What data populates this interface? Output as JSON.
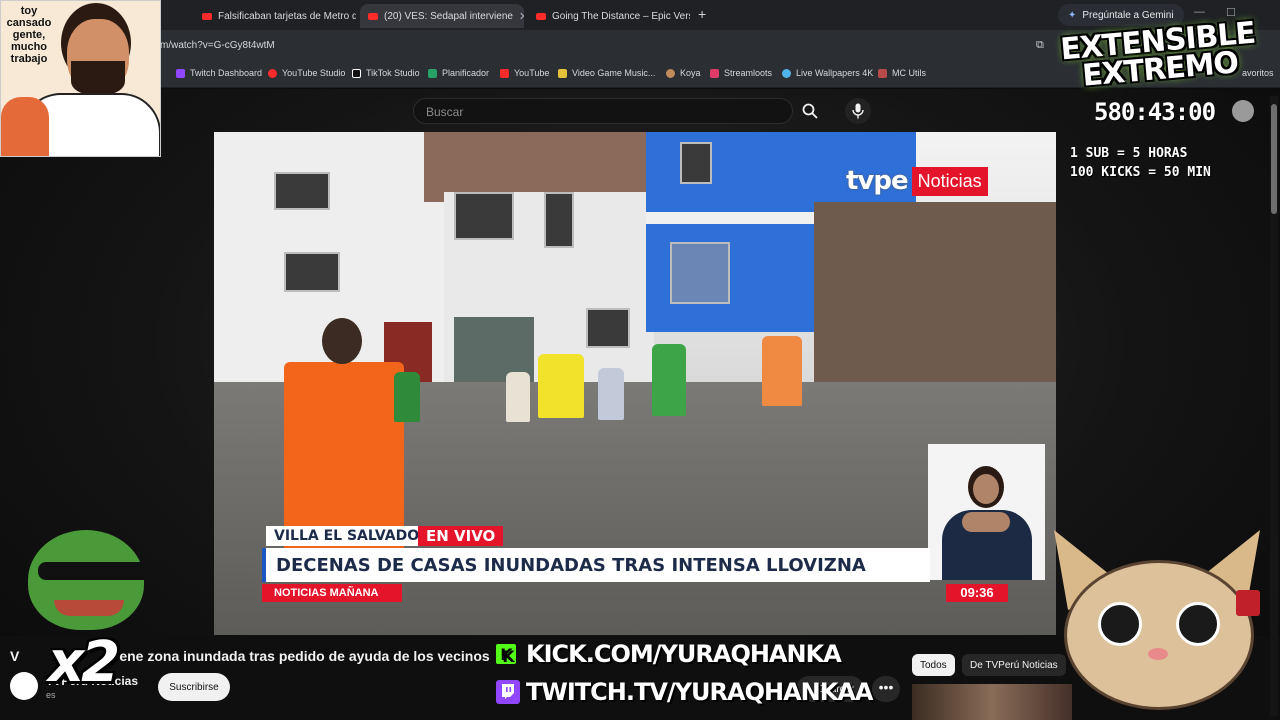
{
  "browser": {
    "tabs": [
      {
        "label": "Falsificaban tarjetas de Metro d"
      },
      {
        "label": "(20) VES: Sedapal interviene"
      },
      {
        "label": "Going The Distance – Epic Vers"
      }
    ],
    "gemini_label": "Pregúntale a Gemini",
    "url": "m/watch?v=G-cGy8t4wtM",
    "bookmarks": [
      "Twitch Dashboard",
      "YouTube Studio",
      "TikTok Studio",
      "Planificador",
      "YouTube",
      "Video Game Music...",
      "Koya",
      "Streamloots",
      "Live Wallpapers 4K",
      "MC Utils"
    ],
    "bookmarks_more": "avoritos"
  },
  "youtube": {
    "search_placeholder": "Buscar",
    "video_title_partial": "V",
    "video_title_rest": "ene zona inundada tras pedido de ayuda de los vecinos",
    "channel_name": "TVPerú Noticias",
    "channel_subs": "es",
    "subscribe_label": "Suscribirse",
    "save_label": "Guardar",
    "chips": [
      "Todos",
      "De TVPerú Noticias"
    ]
  },
  "broadcast": {
    "logo": "tvpe",
    "logo_label": "Noticias",
    "location": "VILLA EL SALVADOR",
    "live": "EN VIVO",
    "headline": "DECENAS DE CASAS INUNDADAS TRAS INTENSA LLOVIZNA",
    "program": "NOTICIAS MAÑANA",
    "clock": "09:36"
  },
  "overlay": {
    "webcam_caption": "toy cansado gente, mucho trabajo",
    "title": "EXTENSIBLE EXTREMO",
    "timer": "580:43:00",
    "rule1": "1 SUB = 5 HORAS",
    "rule2": "100 KICKS = 50 MIN",
    "kick_url": "KICK.COM/YURAQHANKA",
    "kick_logo": "K",
    "twitch_url": "TWITCH.TV/YURAQHANKAA",
    "multiplier": "x2"
  },
  "colors": {
    "accent_red": "#e4152b",
    "kick_green": "#53fc18",
    "twitch_purple": "#9146ff"
  }
}
